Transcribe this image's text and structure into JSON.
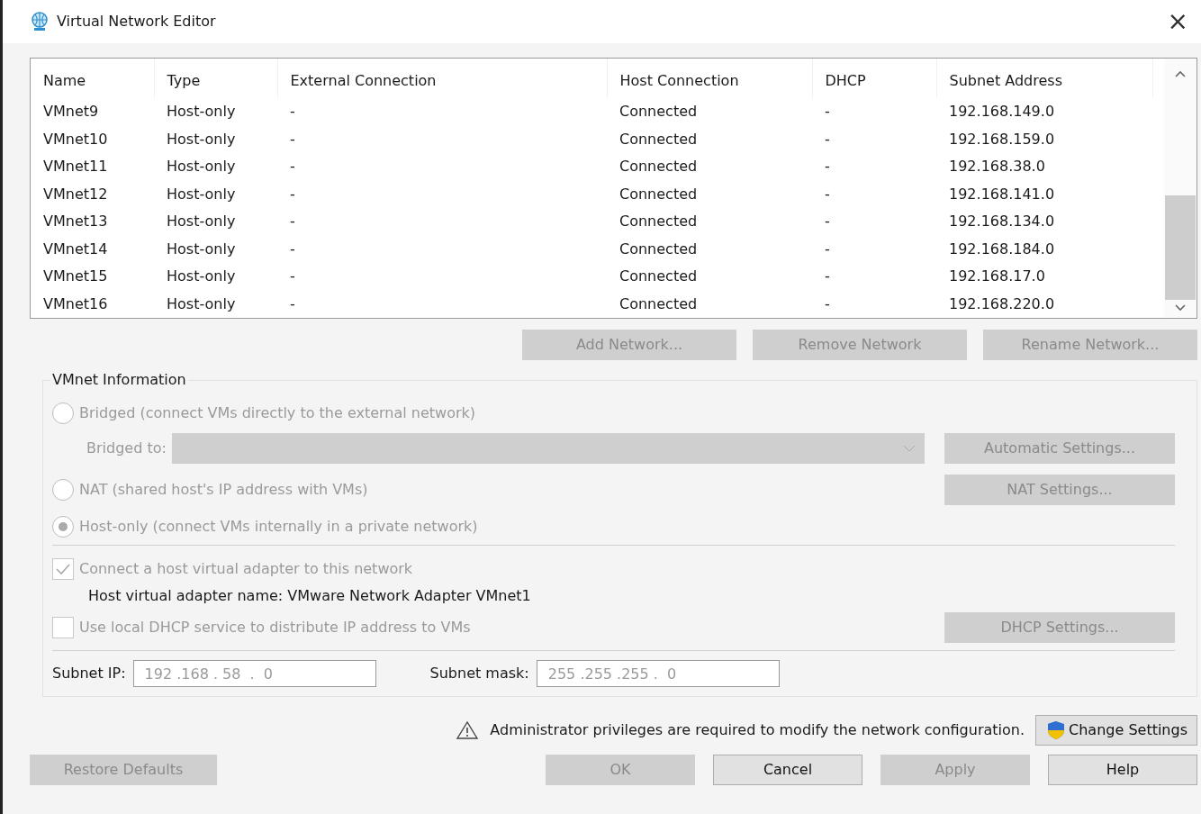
{
  "window": {
    "title": "Virtual Network Editor",
    "close": "×"
  },
  "table": {
    "columns": [
      "Name",
      "Type",
      "External Connection",
      "Host Connection",
      "DHCP",
      "Subnet Address"
    ],
    "rows": [
      [
        "VMnet9",
        "Host-only",
        "-",
        "Connected",
        "-",
        "192.168.149.0"
      ],
      [
        "VMnet10",
        "Host-only",
        "-",
        "Connected",
        "-",
        "192.168.159.0"
      ],
      [
        "VMnet11",
        "Host-only",
        "-",
        "Connected",
        "-",
        "192.168.38.0"
      ],
      [
        "VMnet12",
        "Host-only",
        "-",
        "Connected",
        "-",
        "192.168.141.0"
      ],
      [
        "VMnet13",
        "Host-only",
        "-",
        "Connected",
        "-",
        "192.168.134.0"
      ],
      [
        "VMnet14",
        "Host-only",
        "-",
        "Connected",
        "-",
        "192.168.184.0"
      ],
      [
        "VMnet15",
        "Host-only",
        "-",
        "Connected",
        "-",
        "192.168.17.0"
      ],
      [
        "VMnet16",
        "Host-only",
        "-",
        "Connected",
        "-",
        "192.168.220.0"
      ]
    ]
  },
  "network_buttons": [
    {
      "label": "Add Network...",
      "disabled": true
    },
    {
      "label": "Remove Network",
      "disabled": true
    },
    {
      "label": "Rename Network...",
      "disabled": true
    }
  ],
  "vmnet_info": {
    "title": "VMnet Information",
    "modes": [
      {
        "label": "Bridged (connect VMs directly to the external network)",
        "selected": false,
        "disabled": true
      },
      {
        "label": "NAT (shared host's IP address with VMs)",
        "selected": false,
        "disabled": true
      },
      {
        "label": "Host-only (connect VMs internally in a private network)",
        "selected": true,
        "disabled": true
      }
    ],
    "bridged_to_label": "Bridged to:",
    "bridged_select_disabled": true,
    "automatic_settings": {
      "label": "Automatic Settings...",
      "disabled": true
    },
    "nat_settings": {
      "label": "NAT Settings...",
      "disabled": true
    },
    "connect_adapter": {
      "label": "Connect a host virtual adapter to this network",
      "checked": true,
      "disabled": true
    },
    "adapter_name": "Host virtual adapter name: VMware Network Adapter VMnet1",
    "use_dhcp": {
      "label": "Use local DHCP service to distribute IP address to VMs",
      "checked": false,
      "disabled": true
    },
    "dhcp_settings": {
      "label": "DHCP Settings...",
      "disabled": true
    },
    "subnet_ip": {
      "label": "Subnet IP:",
      "value": "192 .168 . 58  .  0"
    },
    "subnet_mask": {
      "label": "Subnet mask:",
      "value": "255 .255 .255 .  0"
    }
  },
  "warning": "Administrator privileges are required to modify the network configuration.",
  "change_settings": {
    "label": "Change Settings",
    "disabled": false
  },
  "footer_buttons": [
    {
      "label": "Restore Defaults",
      "disabled": true
    },
    {
      "label": "OK",
      "disabled": true
    },
    {
      "label": "Cancel",
      "disabled": false
    },
    {
      "label": "Apply",
      "disabled": true
    },
    {
      "label": "Help",
      "disabled": false
    }
  ]
}
